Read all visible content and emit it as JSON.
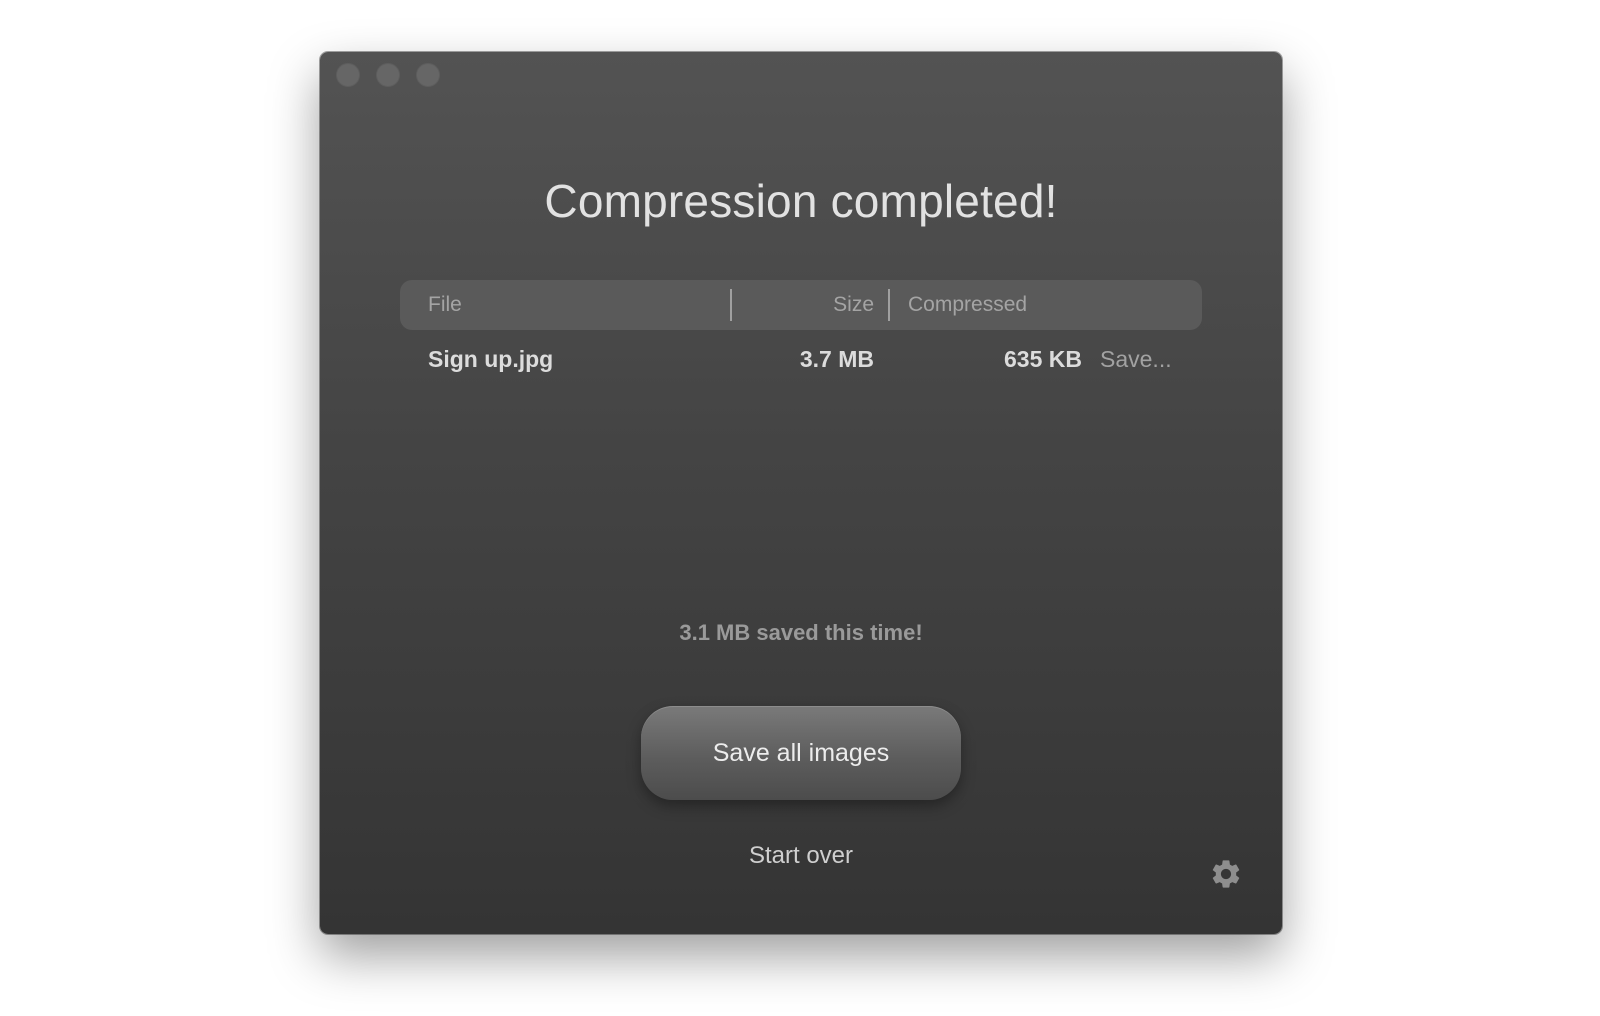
{
  "window": {
    "title": "Compression completed!"
  },
  "table": {
    "headers": {
      "file": "File",
      "size": "Size",
      "compressed": "Compressed"
    },
    "rows": [
      {
        "file": "Sign up.jpg",
        "size": "3.7 MB",
        "compressed": "635 KB",
        "action": "Save..."
      }
    ]
  },
  "summary": {
    "saved_text": "3.1 MB saved this time!"
  },
  "actions": {
    "save_all_label": "Save all images",
    "start_over_label": "Start over"
  },
  "icons": {
    "traffic_lights": [
      "close-icon",
      "minimize-icon",
      "zoom-icon"
    ],
    "settings": "gear-icon"
  },
  "colors": {
    "window_top": "#535353",
    "window_bottom": "#343434",
    "header_bg": "#5a5a5a",
    "button_bg": "#6a6a6a",
    "text_primary": "#e2e2e2",
    "text_secondary": "#a4a4a4"
  }
}
